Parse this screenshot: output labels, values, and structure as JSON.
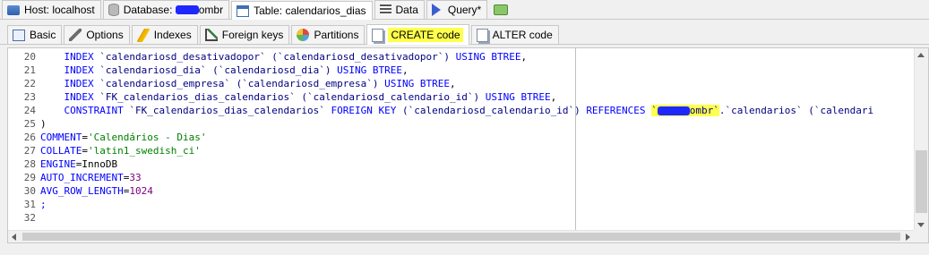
{
  "top_tabs": [
    {
      "label": "Host: localhost",
      "icon": "host-icon"
    },
    {
      "label_prefix": "Database: ",
      "label_suffix": "ombr",
      "icon": "database-icon"
    },
    {
      "label": "Table: calendarios_dias",
      "icon": "table-icon"
    },
    {
      "label": "Data",
      "icon": "data-grid-icon"
    },
    {
      "label": "Query*",
      "icon": "query-play-icon"
    },
    {
      "icon": "new-query-icon"
    }
  ],
  "sub_tabs": [
    {
      "label": "Basic",
      "icon": "basic-table-icon"
    },
    {
      "label": "Options",
      "icon": "wrench-icon"
    },
    {
      "label": "Indexes",
      "icon": "lightning-icon"
    },
    {
      "label": "Foreign keys",
      "icon": "foreign-key-icon"
    },
    {
      "label": "Partitions",
      "icon": "partitions-pie-icon"
    },
    {
      "label": "CREATE code",
      "icon": "create-code-document-icon"
    },
    {
      "label": "ALTER code",
      "icon": "alter-code-document-icon"
    }
  ],
  "editor": {
    "line_numbers": [
      "20",
      "21",
      "22",
      "23",
      "24",
      "25",
      "26",
      "27",
      "28",
      "29",
      "30",
      "31",
      "32"
    ],
    "lines": {
      "l20": {
        "kw1": "INDEX",
        "id": " `calendariosd_desativadopor` (`calendariosd_desativadopor`) ",
        "kw2": "USING BTREE",
        "tail": ","
      },
      "l21": {
        "kw1": "INDEX",
        "id": " `calendariosd_dia` (`calendariosd_dia`) ",
        "kw2": "USING BTREE",
        "tail": ","
      },
      "l22": {
        "kw1": "INDEX",
        "id": " `calendariosd_empresa` (`calendariosd_empresa`) ",
        "kw2": "USING BTREE",
        "tail": ","
      },
      "l23": {
        "kw1": "INDEX",
        "id": " `FK_calendarios_dias_calendarios` (`calendariosd_calendario_id`) ",
        "kw2": "USING BTREE",
        "tail": ","
      },
      "l24": {
        "kw1": "CONSTRAINT",
        "id1": " `FK_calendarios_dias_calendarios` ",
        "kw2": "FOREIGN KEY",
        "id2": " (`calendariosd_calendario_id`) ",
        "kw3": "REFERENCES",
        "sp": " ",
        "ref_open": "`",
        "ref_suffix": "ombr`",
        "id3": ".`calendarios` (`calendari"
      },
      "l25": ")",
      "l26": {
        "kw": "COMMENT",
        "eq": "=",
        "str": "'Calendários - Dias'"
      },
      "l27": {
        "kw": "COLLATE",
        "eq": "=",
        "str": "'latin1_swedish_ci'"
      },
      "l28": {
        "kw": "ENGINE",
        "eq": "=",
        "val": "InnoDB"
      },
      "l29": {
        "kw": "AUTO_INCREMENT",
        "eq": "=",
        "num": "33"
      },
      "l30": {
        "kw": "AVG_ROW_LENGTH",
        "eq": "=",
        "num": "1024"
      },
      "l31": ";",
      "l32": ""
    }
  },
  "colors": {
    "keyword": "#0000ff",
    "identifier": "#000080",
    "string": "#008000",
    "number": "#800080",
    "highlight": "#ffff4d",
    "redaction": "#1f27ff"
  }
}
